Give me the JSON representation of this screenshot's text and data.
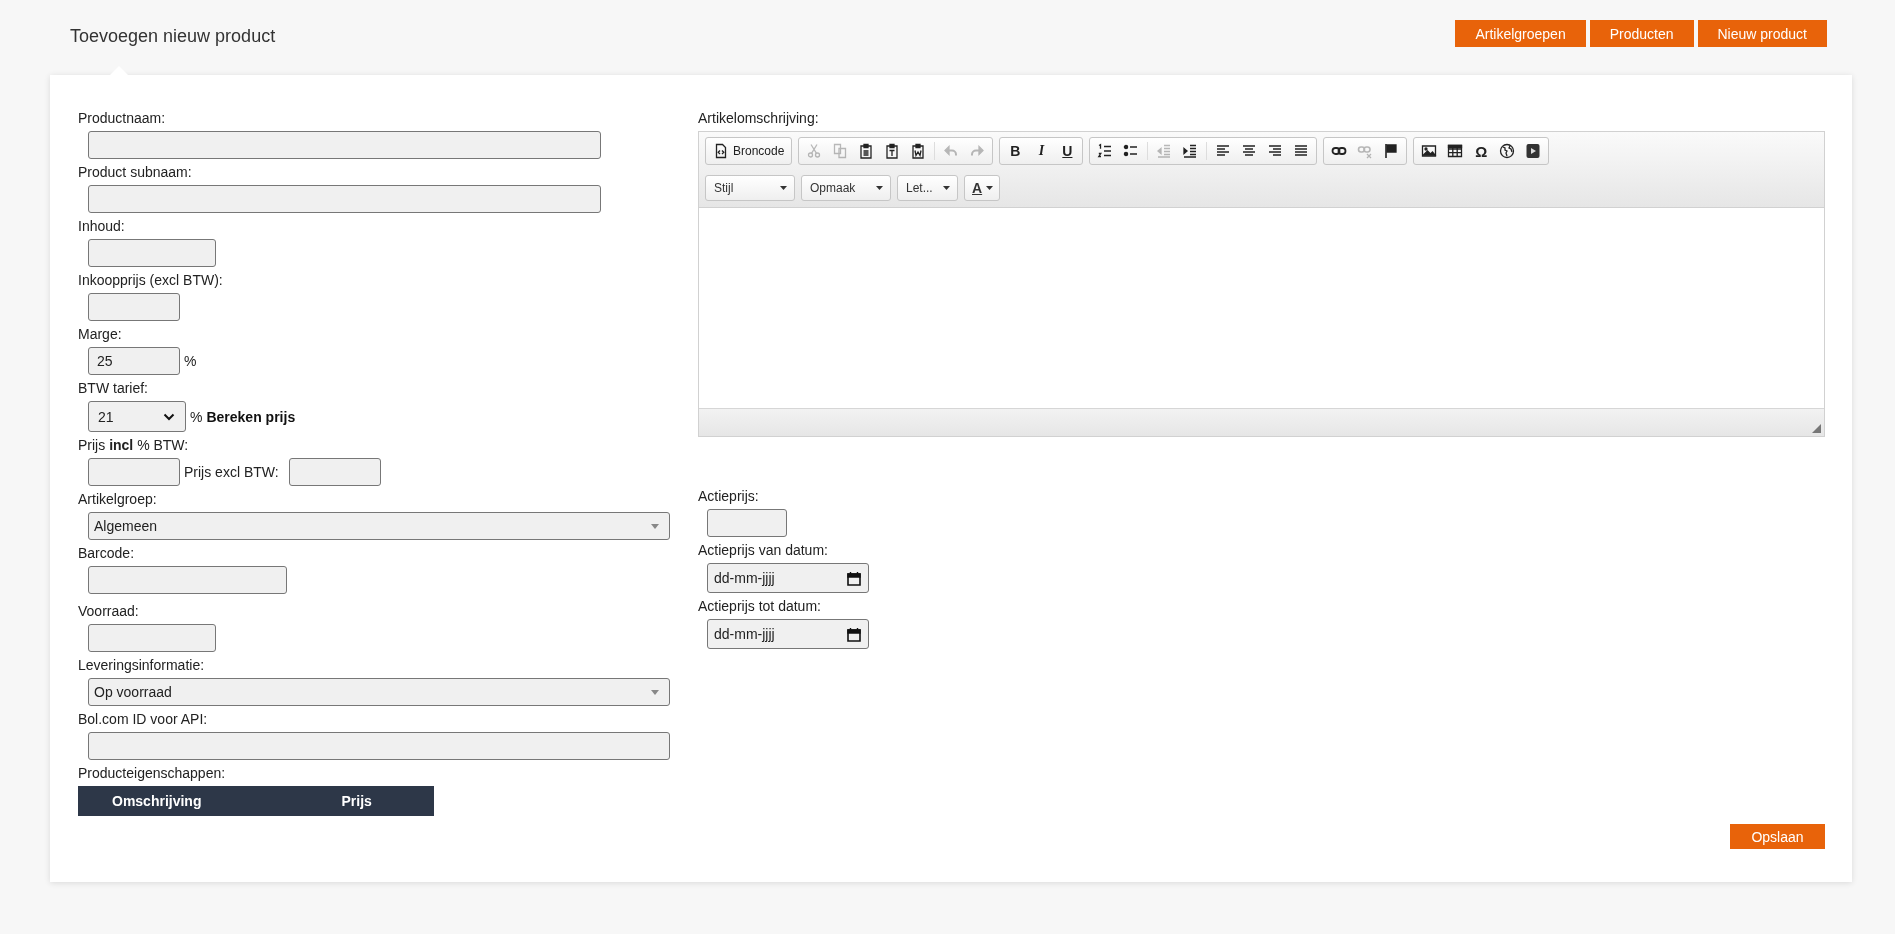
{
  "header": {
    "title": "Toevoegen nieuw product",
    "buttons": [
      "Artikelgroepen",
      "Producten",
      "Nieuw product"
    ]
  },
  "form": {
    "product_name": {
      "label": "Productnaam:"
    },
    "product_subname": {
      "label": "Product subnaam:"
    },
    "content": {
      "label": "Inhoud:"
    },
    "purchase_price": {
      "label": "Inkoopprijs (excl BTW):"
    },
    "margin": {
      "label": "Marge:",
      "value": "25",
      "unit": "%"
    },
    "vat_rate": {
      "label": "BTW tarief:",
      "value": "21",
      "unit": "%",
      "action": "Bereken prijs"
    },
    "price_incl": {
      "label": "Prijs **incl** % BTW:"
    },
    "price_excl": {
      "label": "Prijs excl BTW:"
    },
    "article_group": {
      "label": "Artikelgroep:",
      "value": "Algemeen"
    },
    "barcode": {
      "label": "Barcode:"
    },
    "stock": {
      "label": "Voorraad:"
    },
    "delivery_info": {
      "label": "Leveringsinformatie:",
      "value": "Op voorraad"
    },
    "bol_id": {
      "label": "Bol.com ID voor API:"
    },
    "properties": {
      "label": "Producteigenschappen:",
      "columns": [
        "Omschrijving",
        "Prijs"
      ]
    }
  },
  "editor": {
    "label": "Artikelomschrijving:",
    "toolbar_groups": [
      {
        "items": [
          {
            "kind": "source",
            "label": "Broncode",
            "disabled": false
          }
        ]
      },
      {
        "items": [
          {
            "kind": "cut",
            "disabled": true
          },
          {
            "kind": "copy",
            "disabled": true
          },
          {
            "kind": "paste",
            "disabled": false
          },
          {
            "kind": "paste-text",
            "disabled": false
          },
          {
            "kind": "paste-word",
            "disabled": false
          },
          {
            "kind": "separator"
          },
          {
            "kind": "undo",
            "disabled": true
          },
          {
            "kind": "redo",
            "disabled": true
          }
        ]
      },
      {
        "items": [
          {
            "kind": "bold",
            "label": "B",
            "disabled": false
          },
          {
            "kind": "italic",
            "label": "I",
            "disabled": false
          },
          {
            "kind": "underline",
            "label": "U",
            "disabled": false
          }
        ]
      },
      {
        "items": [
          {
            "kind": "numbered-list",
            "disabled": false
          },
          {
            "kind": "bullet-list",
            "disabled": false
          },
          {
            "kind": "separator"
          },
          {
            "kind": "outdent",
            "disabled": true
          },
          {
            "kind": "indent",
            "disabled": false
          },
          {
            "kind": "separator"
          },
          {
            "kind": "align-left",
            "disabled": false
          },
          {
            "kind": "align-center",
            "disabled": false
          },
          {
            "kind": "align-right",
            "disabled": false
          },
          {
            "kind": "justify",
            "disabled": false
          }
        ]
      },
      {
        "items": [
          {
            "kind": "link",
            "disabled": false
          },
          {
            "kind": "unlink",
            "disabled": true
          },
          {
            "kind": "anchor",
            "disabled": false
          }
        ]
      },
      {
        "items": [
          {
            "kind": "image",
            "disabled": false
          },
          {
            "kind": "table",
            "disabled": false
          },
          {
            "kind": "special-char",
            "label": "Ω",
            "disabled": false
          },
          {
            "kind": "globe",
            "disabled": false
          },
          {
            "kind": "video",
            "disabled": false
          }
        ]
      }
    ],
    "format_controls": [
      {
        "kind": "combo",
        "label": "Stijl"
      },
      {
        "kind": "combo",
        "label": "Opmaak"
      },
      {
        "kind": "combo",
        "label": "Let..."
      },
      {
        "kind": "text-color",
        "label": "A"
      }
    ]
  },
  "promo": {
    "price": {
      "label": "Actieprijs:"
    },
    "from": {
      "label": "Actieprijs van datum:",
      "placeholder": "dd-mm-jjjj"
    },
    "to": {
      "label": "Actieprijs tot datum:",
      "placeholder": "dd-mm-jjjj"
    }
  },
  "save_button": "Opslaan"
}
